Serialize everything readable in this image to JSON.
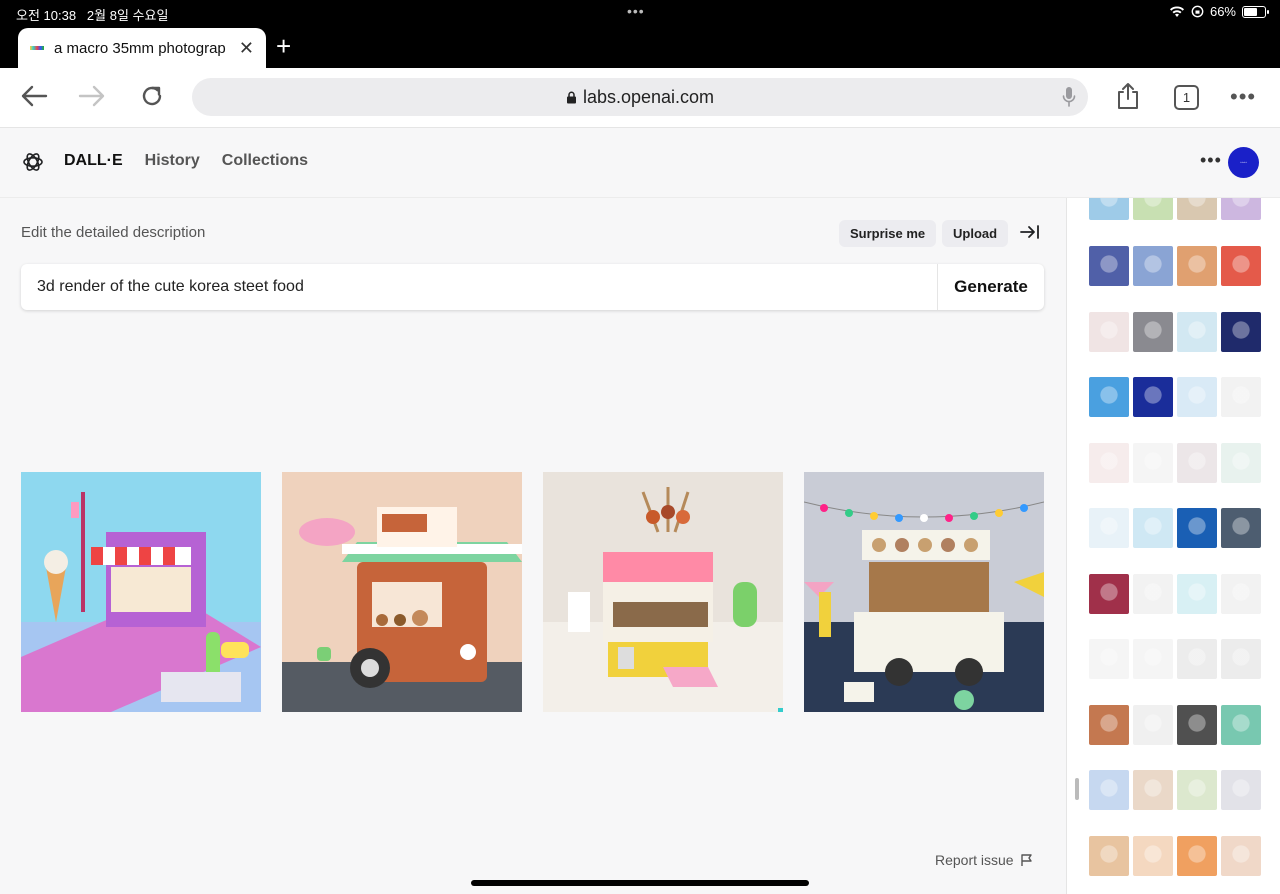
{
  "status_bar": {
    "time": "오전 10:38",
    "date": "2월 8일 수요일",
    "battery": "66%",
    "battery_level": 0.66
  },
  "browser": {
    "tab_title": "a macro 35mm photograp",
    "url": "labs.openai.com",
    "tab_count": "1"
  },
  "app": {
    "brand": "DALL·E",
    "nav": [
      "History",
      "Collections"
    ],
    "avatar_color": "#1a20c8"
  },
  "prompt": {
    "label": "Edit the detailed description",
    "surprise_label": "Surprise me",
    "upload_label": "Upload",
    "value": "3d render of the cute korea steet food",
    "generate_label": "Generate"
  },
  "results": [
    {
      "name": "result-image-1",
      "palette": [
        "#8ed8ef",
        "#c97bd8",
        "#ff7aa8"
      ],
      "subject": "isometric street food stall"
    },
    {
      "name": "result-image-2",
      "palette": [
        "#efd2bd",
        "#c6643a",
        "#7dd4a0"
      ],
      "subject": "food truck with striped awning"
    },
    {
      "name": "result-image-3",
      "palette": [
        "#e9e3dc",
        "#f1d13c",
        "#ff8aa6"
      ],
      "subject": "food cart with skewers"
    },
    {
      "name": "result-image-4",
      "palette": [
        "#c9ccd6",
        "#f5f3ea",
        "#2b3a55"
      ],
      "subject": "white food truck with bunting"
    }
  ],
  "history_rows": [
    [
      "#9ecbe8",
      "#c8e0b2",
      "#d9c8b0",
      "#cdb7e0"
    ],
    [
      "#5060a8",
      "#8aa4d4",
      "#e0a070",
      "#e45a4a"
    ],
    [
      "#f0e4e4",
      "#8a8a90",
      "#d2e8f2",
      "#1f2a6b"
    ],
    [
      "#4aa0e0",
      "#1a2d9a",
      "#d9eaf6",
      "#f2f2f2"
    ],
    [
      "#f6ecec",
      "#f5f5f5",
      "#ece6e8",
      "#e8f2ee"
    ],
    [
      "#e8f2f8",
      "#cfe8f4",
      "#1a5fb4",
      "#4d5d70"
    ],
    [
      "#a0304a",
      "#f2f2f2",
      "#d8f0f4",
      "#f2f2f2"
    ],
    [
      "#f5f5f5",
      "#f5f5f5",
      "#ececec",
      "#ececec"
    ],
    [
      "#c47850",
      "#f0f0f0",
      "#505050",
      "#78c8b0"
    ],
    [
      "#c6d8f0",
      "#ead8c8",
      "#dce8ce",
      "#e2e2e8"
    ],
    [
      "#e8c4a0",
      "#f4d8c0",
      "#f0a060",
      "#f0d8c8"
    ]
  ],
  "footer": {
    "report_label": "Report issue"
  }
}
